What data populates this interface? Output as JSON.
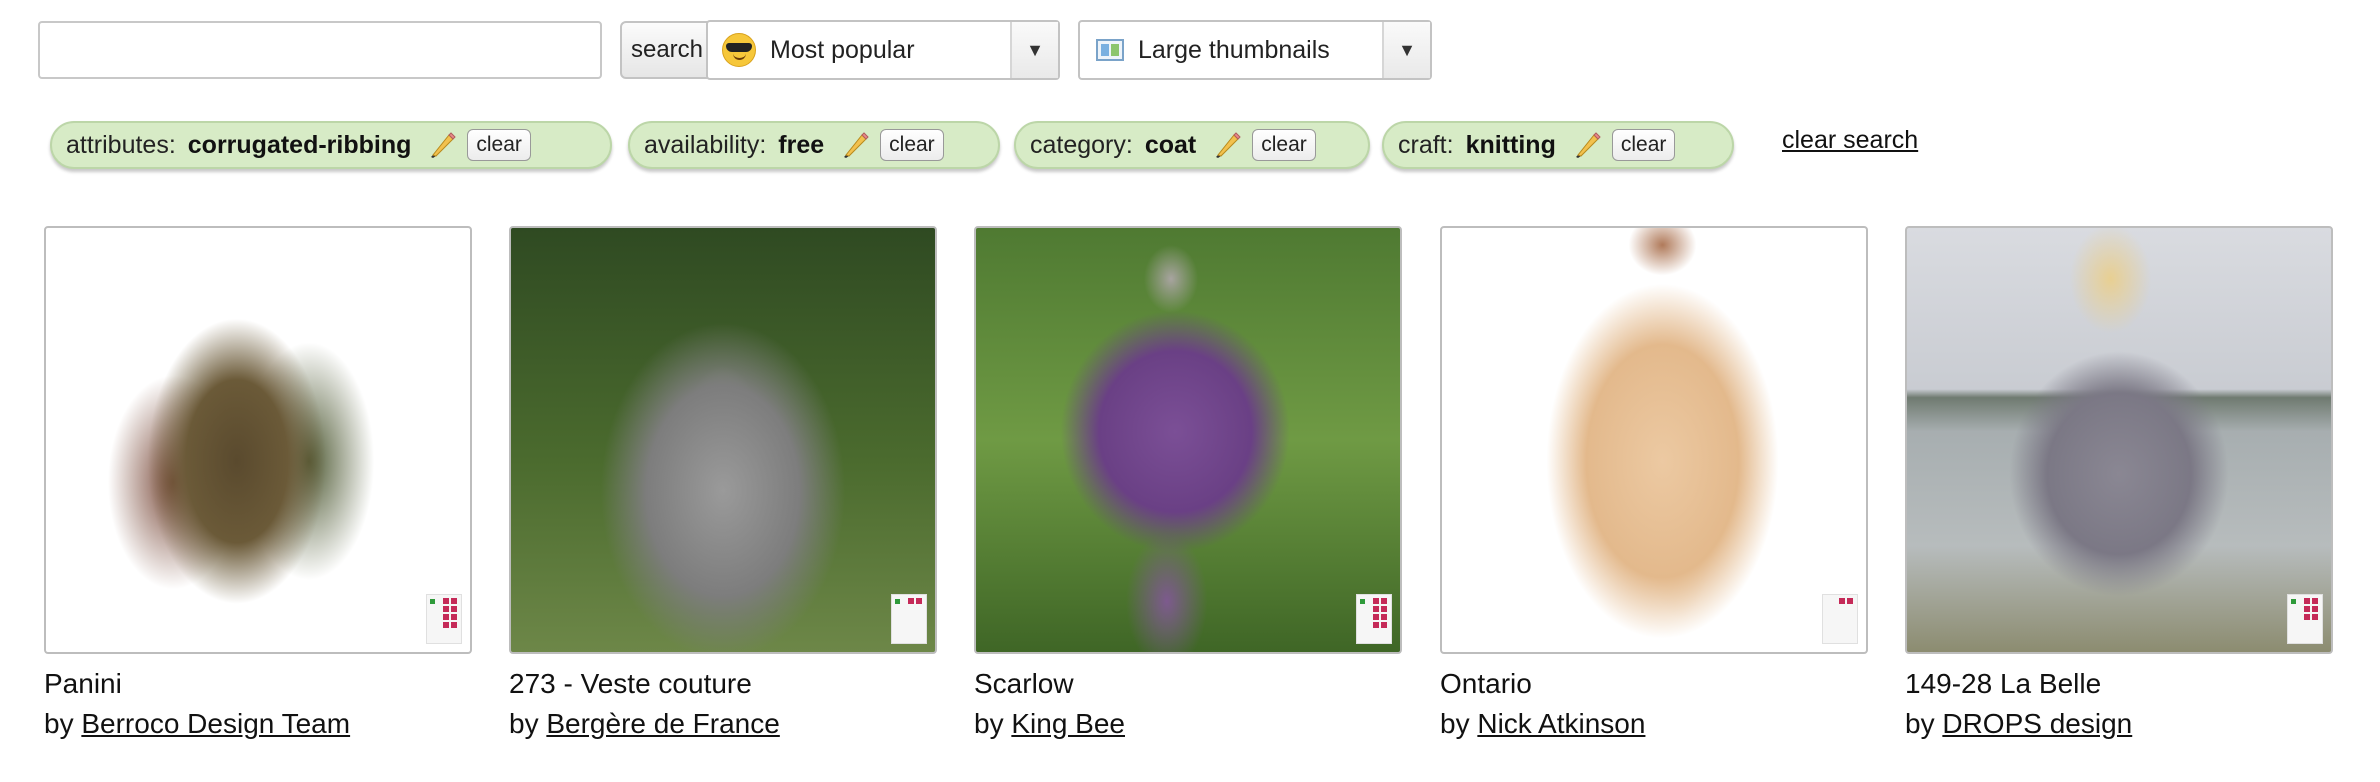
{
  "toolbar": {
    "search_value": "",
    "search_placeholder": "",
    "search_button": "search",
    "sort_selected": "Most popular",
    "view_selected": "Large thumbnails"
  },
  "filters": [
    {
      "key": "attributes:",
      "value": "corrugated-ribbing",
      "clear": "clear"
    },
    {
      "key": "availability:",
      "value": "free",
      "clear": "clear"
    },
    {
      "key": "category:",
      "value": "coat",
      "clear": "clear"
    },
    {
      "key": "craft:",
      "value": "knitting",
      "clear": "clear"
    }
  ],
  "clear_search": "clear search",
  "results": [
    {
      "name": "Panini",
      "by": "by",
      "designer": "Berroco Design Team"
    },
    {
      "name": "273 - Veste couture",
      "by": "by",
      "designer": "Bergère de France"
    },
    {
      "name": "Scarlow",
      "by": "by",
      "designer": "King Bee"
    },
    {
      "name": "Ontario",
      "by": "by",
      "designer": "Nick Atkinson"
    },
    {
      "name": "149-28 La Belle",
      "by": "by",
      "designer": "DROPS design"
    }
  ],
  "colors": {
    "chip_background": "#d7ebc6",
    "chip_border": "#bcd6a8",
    "badge_pink": "#c52a58",
    "badge_green": "#2e9a3a"
  },
  "icons": {
    "sort": "sunglasses-emoji-icon",
    "view": "thumbnail-icon",
    "edit": "pencil-icon",
    "dropdown": "triangle-down-icon"
  }
}
